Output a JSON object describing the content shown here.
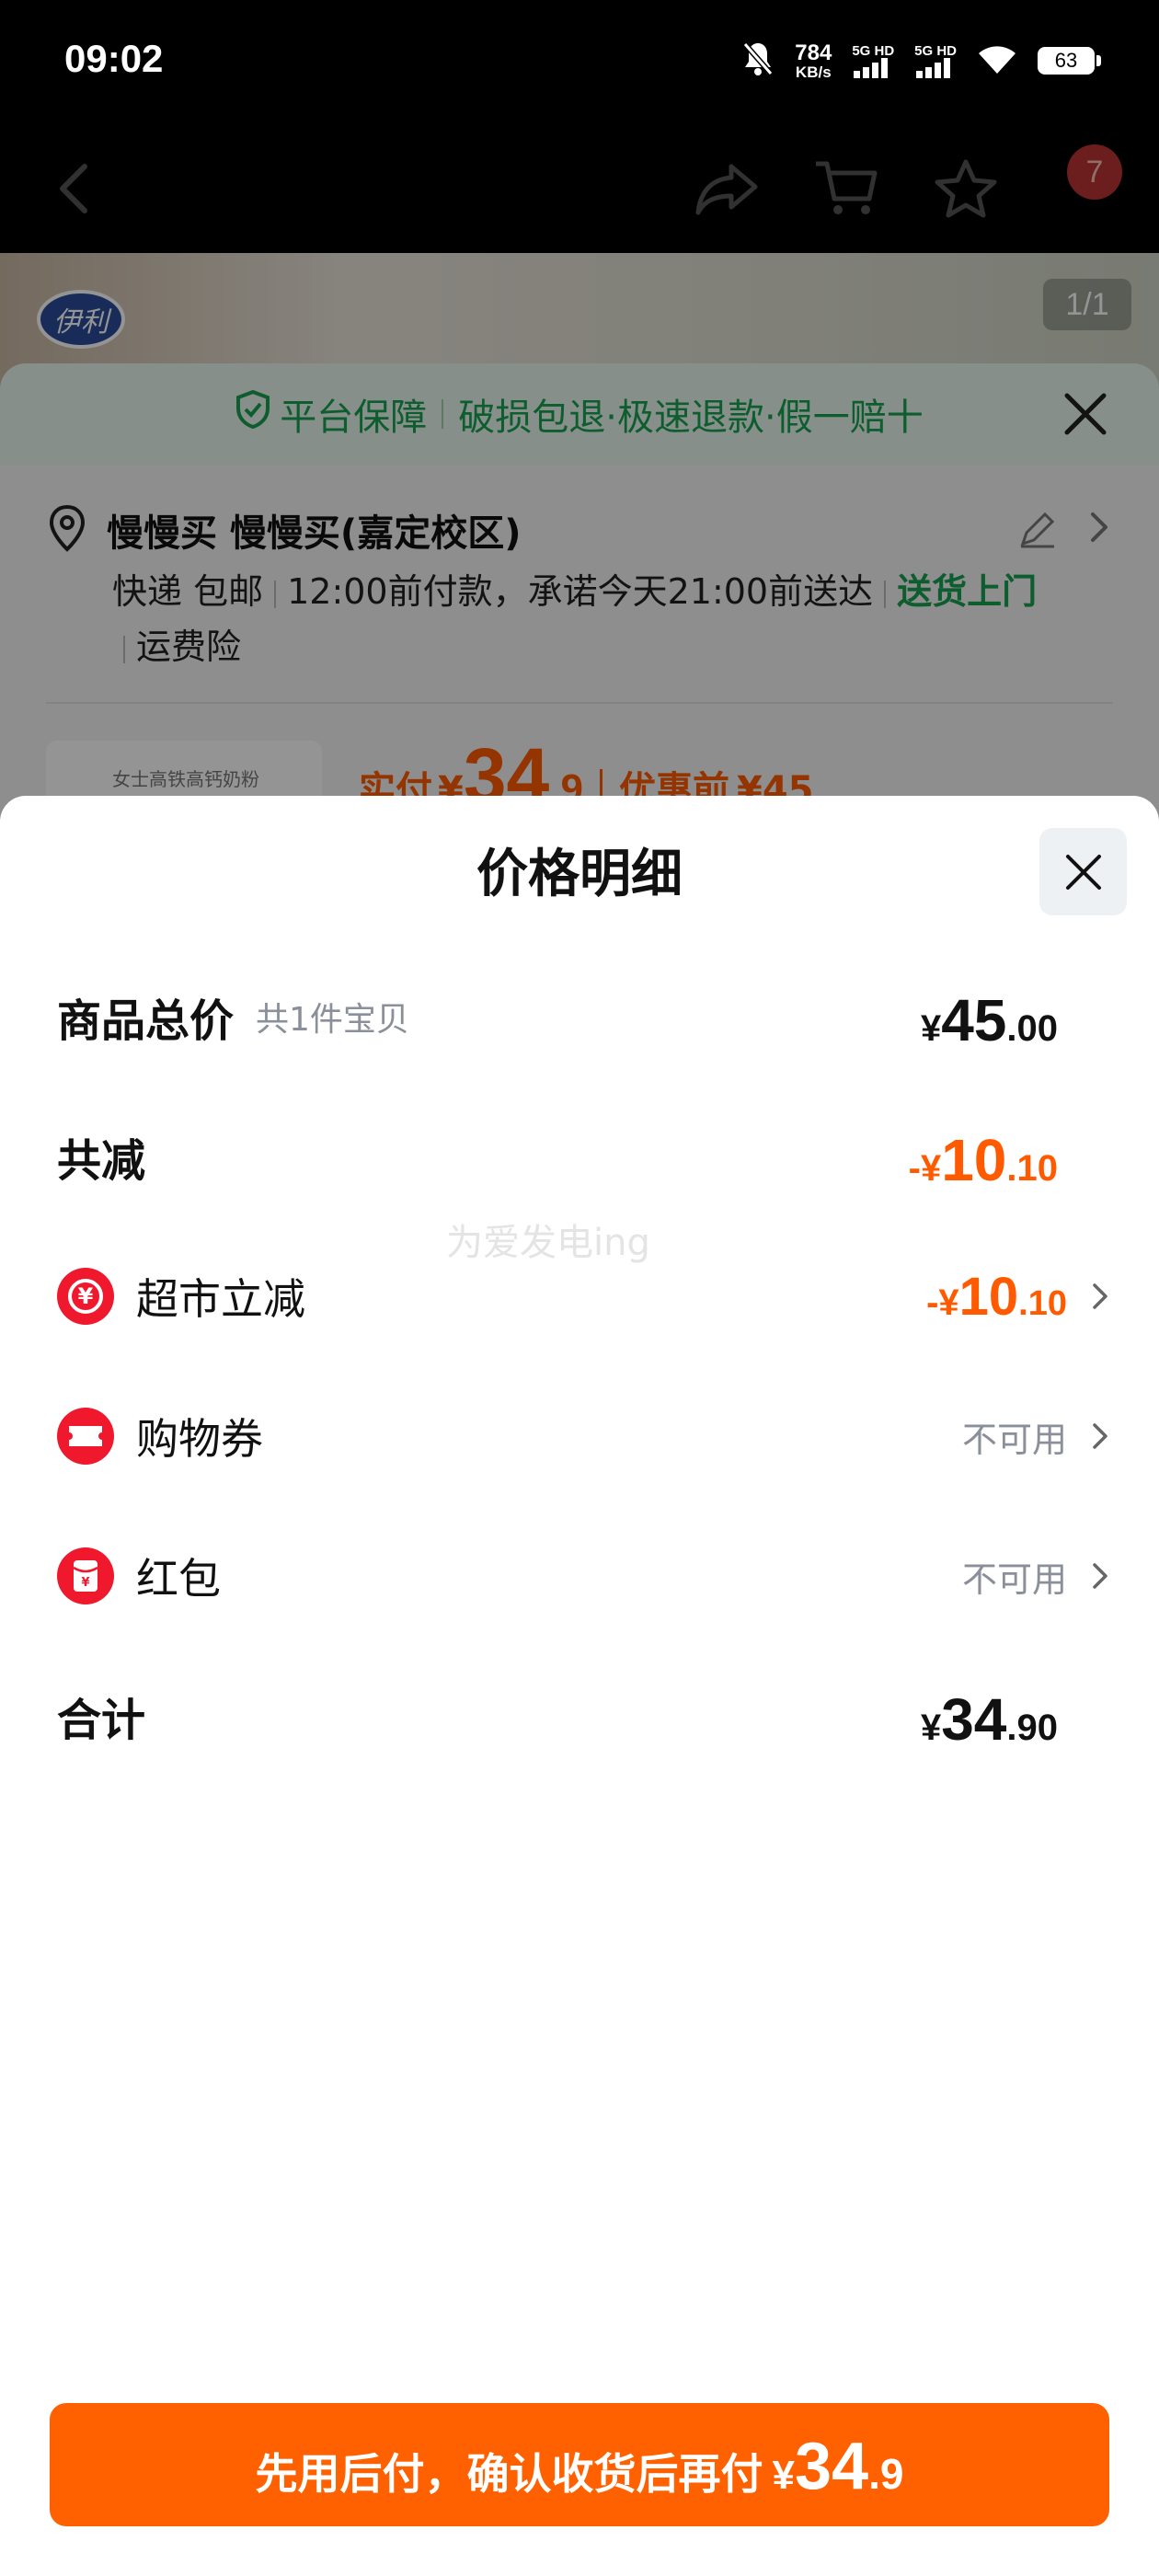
{
  "status_bar": {
    "time": "09:02",
    "net_speed_value": "784",
    "net_speed_unit": "KB/s",
    "sim1_label": "5G HD",
    "sim2_label": "5G HD",
    "battery": "63"
  },
  "nav": {
    "cart_badge": "7"
  },
  "product": {
    "brand_logo_text": "伊利",
    "image_pager": "1/1",
    "thumb_text": "女士高铁高钙奶粉"
  },
  "guarantee": {
    "label": "平台保障",
    "detail": "破损包退·极速退款·假一赔十"
  },
  "address": {
    "name": "慢慢买 慢慢买(嘉定校区)",
    "shipping_method": "快递 包邮",
    "promise": "12:00前付款，承诺今天21:00前送达",
    "delivery_tag": "送货上门",
    "insurance": "运费险"
  },
  "price_peek": {
    "actual_label": "实付",
    "currency": "¥",
    "int": "34",
    "dec": ".9",
    "before_label": "优惠前",
    "before_amount": "¥45"
  },
  "sheet": {
    "title": "价格明细",
    "rows": {
      "total_goods": {
        "label": "商品总价",
        "sub": "共1件宝贝",
        "prefix": "",
        "currency": "¥",
        "int": "45",
        "dec": ".00"
      },
      "total_discount": {
        "label": "共减",
        "prefix": "-",
        "currency": "¥",
        "int": "10",
        "dec": ".10"
      },
      "supermarket": {
        "label": "超市立减",
        "icon_glyph": "¥",
        "prefix": "-",
        "currency": "¥",
        "int": "10",
        "dec": ".10"
      },
      "coupon": {
        "label": "购物券",
        "status": "不可用"
      },
      "red_packet": {
        "label": "红包",
        "icon_glyph": "¥",
        "status": "不可用"
      },
      "sum": {
        "label": "合计",
        "currency": "¥",
        "int": "34",
        "dec": ".90"
      }
    },
    "watermark": "为爱发电ing"
  },
  "pay_button": {
    "label": "先用后付，确认收货后再付",
    "currency": "¥",
    "int": "34",
    "dec": ".9"
  },
  "colors": {
    "accent_orange": "#ff6000",
    "discount_orange": "#ff5a00",
    "guarantee_green": "#17a050",
    "icon_red": "#f0182d"
  }
}
